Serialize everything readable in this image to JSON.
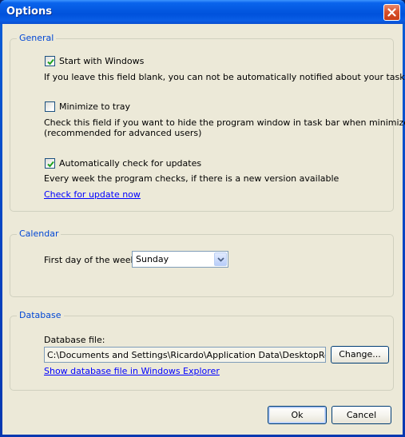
{
  "window": {
    "title": "Options"
  },
  "general": {
    "legend": "General",
    "start_with_windows": {
      "label": "Start with Windows",
      "checked": true,
      "description": "If you leave this field blank, you can not be automatically notified about your tasks"
    },
    "minimize_to_tray": {
      "label": "Minimize to tray",
      "checked": false,
      "description_line1": "Check this field if you want to hide the program window in task bar when minimized",
      "description_line2": "(recommended for advanced users)"
    },
    "auto_update": {
      "label": "Automatically check for updates",
      "checked": true,
      "description": "Every week the program checks, if there is a new version available"
    },
    "check_now_link": "Check for update now"
  },
  "calendar": {
    "legend": "Calendar",
    "first_day_label": "First day of the week:",
    "first_day_value": "Sunday"
  },
  "database": {
    "legend": "Database",
    "file_label": "Database file:",
    "file_path": "C:\\Documents and Settings\\Ricardo\\Application Data\\DesktopReminder",
    "change_button": "Change...",
    "show_link": "Show database file in Windows Explorer"
  },
  "buttons": {
    "ok": "Ok",
    "cancel": "Cancel"
  },
  "colors": {
    "title_bar": "#0a5ee6",
    "dialog_bg": "#ece9d8",
    "group_legend": "#0046d5",
    "link": "#0000ff"
  },
  "icons": {
    "close": "close-icon",
    "check": "checkmark-icon",
    "dropdown": "chevron-down-icon"
  }
}
